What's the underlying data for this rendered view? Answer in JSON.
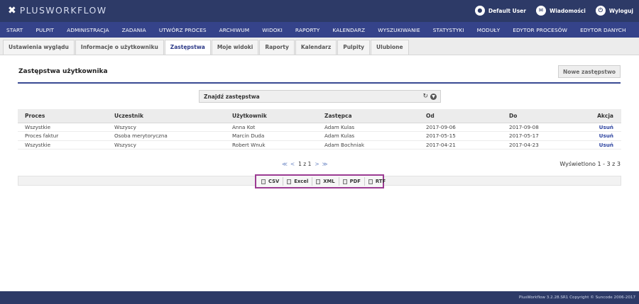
{
  "header": {
    "logo_x": "✖",
    "logo_text": "PLUSWORKFLOW",
    "user_label": "Default User",
    "messages_label": "Wiadomości",
    "logout_label": "Wyloguj"
  },
  "nav": {
    "items": [
      "START",
      "PULPIT",
      "ADMINISTRACJA",
      "ZADANIA",
      "UTWÓRZ PROCES",
      "ARCHIWUM",
      "WIDOKI",
      "RAPORTY",
      "KALENDARZ",
      "WYSZUKIWANIE",
      "STATYSTYKI",
      "MODUŁY",
      "EDYTOR PROCESÓW",
      "EDYTOR DANYCH"
    ]
  },
  "tabs": {
    "items": [
      "Ustawienia wyglądu",
      "Informacje o użytkowniku",
      "Zastępstwa",
      "Moje widoki",
      "Raporty",
      "Kalendarz",
      "Pulpity",
      "Ulubione"
    ],
    "active_index": 2
  },
  "page": {
    "title": "Zastępstwa użytkownika",
    "new_button": "Nowe zastępstwo"
  },
  "find": {
    "label": "Znajdź zastępstwa"
  },
  "table": {
    "columns": [
      "Proces",
      "Uczestnik",
      "Użytkownik",
      "Zastępca",
      "Od",
      "Do",
      "Akcja"
    ],
    "rows": [
      [
        "Wszystkie",
        "Wszyscy",
        "Anna Kot",
        "Adam Kulas",
        "2017-09-06",
        "2017-09-08",
        "Usuń"
      ],
      [
        "Proces faktur",
        "Osoba merytoryczna",
        "Marcin Duda",
        "Adam Kulas",
        "2017-05-15",
        "2017-05-17",
        "Usuń"
      ],
      [
        "Wszystkie",
        "Wszyscy",
        "Robert Wnuk",
        "Adam Bochniak",
        "2017-04-21",
        "2017-04-23",
        "Usuń"
      ]
    ]
  },
  "pager": {
    "first": "≪",
    "prev": "<",
    "info": "1 z 1",
    "next": ">",
    "last": "≫",
    "records": "Wyświetlono 1 - 3 z 3"
  },
  "export": {
    "buttons": [
      "CSV",
      "Excel",
      "XML",
      "PDF",
      "RTF"
    ]
  },
  "footer": {
    "copyright": "PlusWorkflow 3.2.28.SR1 Copyright © Suncode 2006-2017"
  },
  "colors": {
    "topbar": "#2d3a67",
    "navbar": "#35438a",
    "accent": "#3a4a93",
    "highlight_box": "#9c3b93"
  }
}
